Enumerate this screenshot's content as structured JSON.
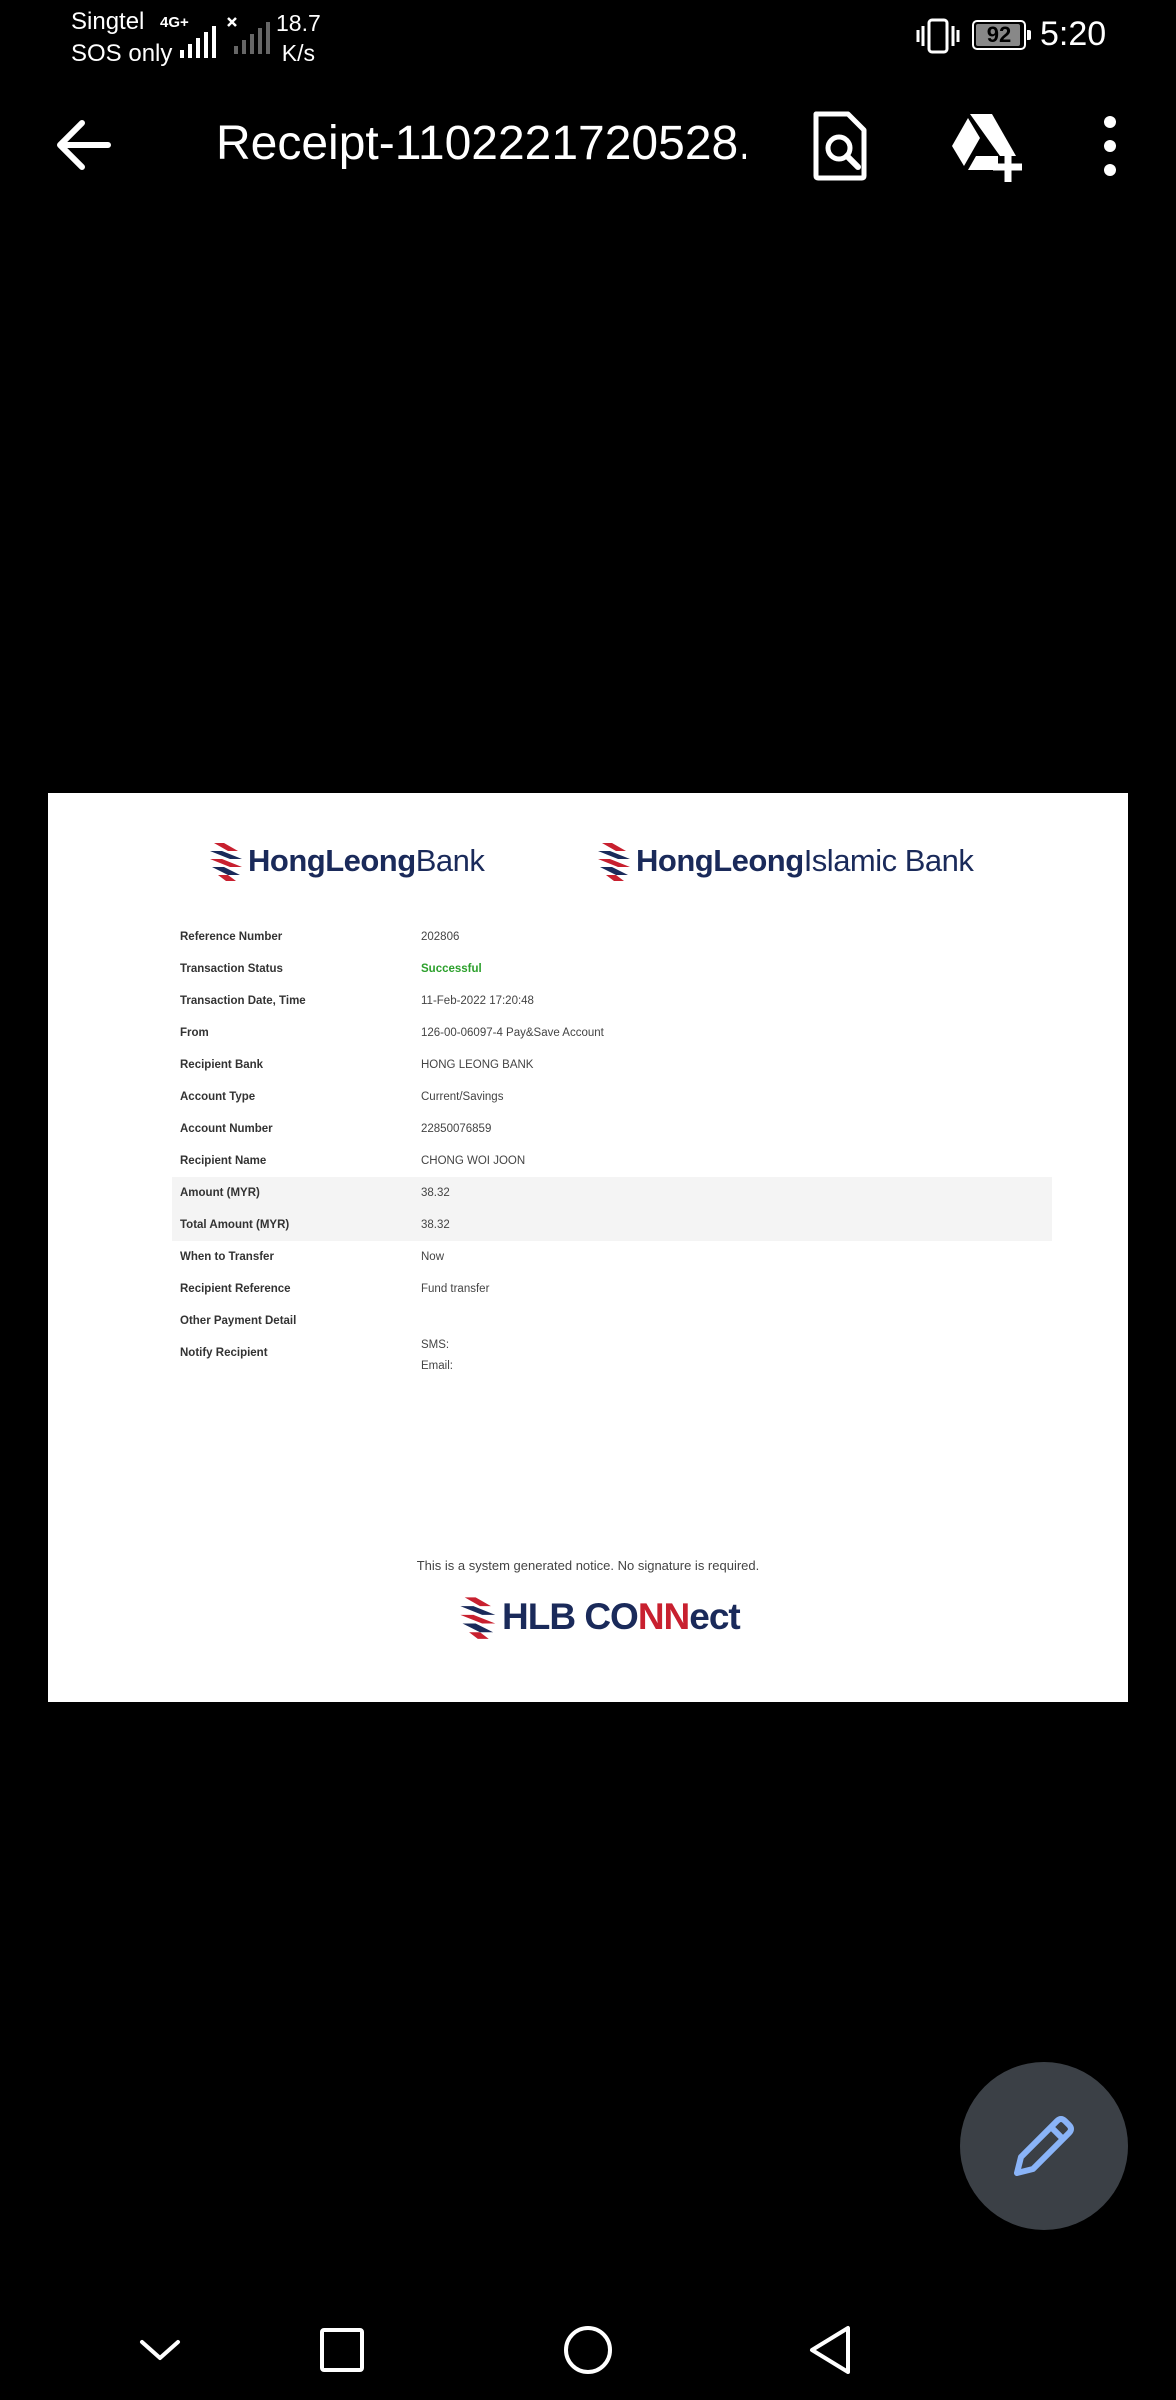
{
  "status_bar": {
    "carrier": "Singtel",
    "carrier_status": "SOS only",
    "network_type": "4G+",
    "net_speed_value": "18.7",
    "net_speed_unit": "K/s",
    "battery": "92",
    "time": "5:20"
  },
  "app_bar": {
    "title": "Receipt-1102221720528...",
    "icons": [
      "back-arrow-icon",
      "find-in-page-icon",
      "add-to-drive-icon",
      "more-vert-icon"
    ]
  },
  "document": {
    "logos": {
      "left_bold": "HongLeong",
      "left_light": "Bank",
      "right_bold": "HongLeong",
      "right_light": "Islamic Bank"
    },
    "rows": [
      {
        "label": "Reference Number",
        "value": "202806"
      },
      {
        "label": "Transaction Status",
        "value": "Successful"
      },
      {
        "label": "Transaction Date, Time",
        "value": "11-Feb-2022 17:20:48"
      },
      {
        "label": "From",
        "value": "126-00-06097-4 Pay&Save Account"
      },
      {
        "label": "Recipient Bank",
        "value": "HONG LEONG BANK"
      },
      {
        "label": "Account Type",
        "value": "Current/Savings"
      },
      {
        "label": "Account Number",
        "value": "22850076859"
      },
      {
        "label": "Recipient Name",
        "value": "CHONG WOI JOON"
      },
      {
        "label": "Amount (MYR)",
        "value": "38.32"
      },
      {
        "label": "Total Amount (MYR)",
        "value": "38.32"
      },
      {
        "label": "When to Transfer",
        "value": "Now"
      },
      {
        "label": "Recipient Reference",
        "value": "Fund transfer"
      },
      {
        "label": "Other Payment Detail",
        "value": ""
      }
    ],
    "notify": {
      "label": "Notify Recipient",
      "sms": "SMS:",
      "email": "Email:"
    },
    "footer_note": "This is a system generated notice. No signature is required.",
    "footer_logo_main": "HLB CO",
    "footer_logo_accent": "NN",
    "footer_logo_end": "ect"
  },
  "colors": {
    "brand_navy": "#1a2a5a",
    "brand_red": "#c8202f",
    "success_green": "#2ca02c",
    "fab_bg": "#3b4046",
    "fab_icon": "#8ab4f8"
  },
  "fab": {
    "icon": "pencil-edit-icon"
  },
  "nav_bar": {
    "icons": [
      "chevron-down-icon",
      "recents-square-icon",
      "home-circle-icon",
      "back-triangle-icon"
    ]
  }
}
